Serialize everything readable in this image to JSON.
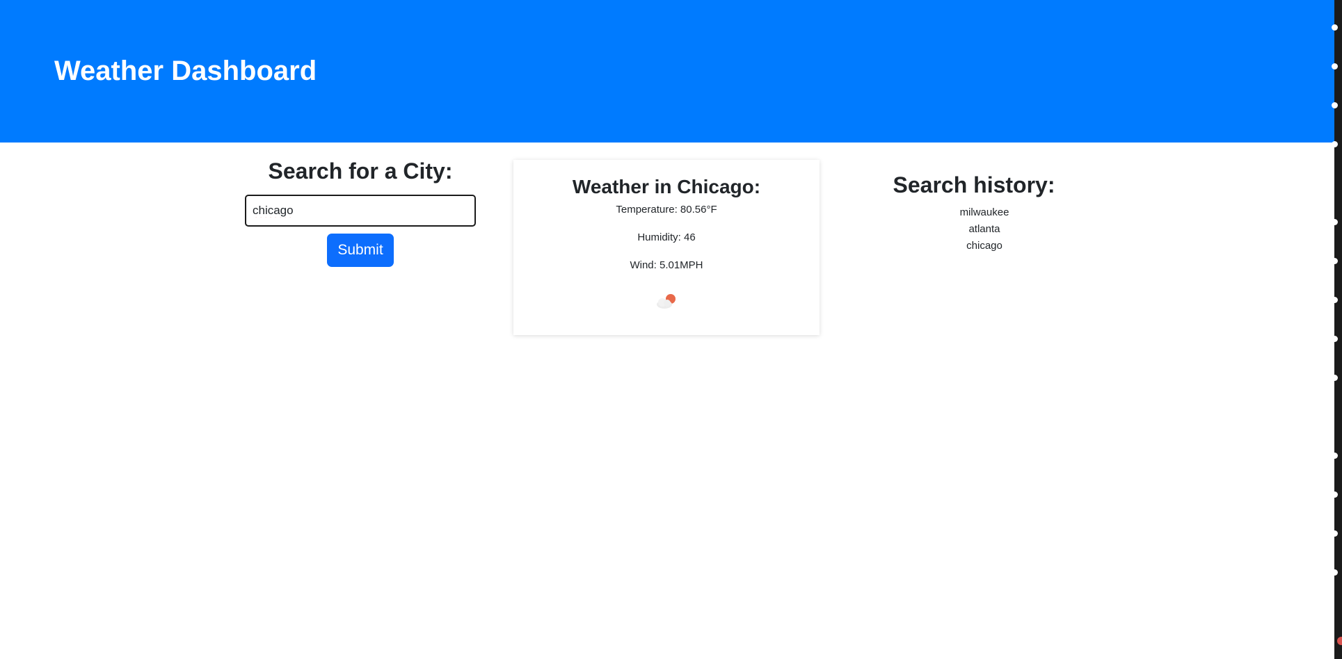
{
  "header": {
    "title": "Weather Dashboard"
  },
  "search": {
    "heading": "Search for a City:",
    "input_value": "chicago",
    "submit_label": "Submit"
  },
  "weather": {
    "title": "Weather in Chicago:",
    "temperature": "Temperature: 80.56°F",
    "humidity": "Humidity: 46",
    "wind": "Wind: 5.01MPH",
    "icon": "partly-cloudy-icon"
  },
  "history": {
    "heading": "Search history:",
    "items": [
      "milwaukee",
      "atlanta",
      "chicago"
    ]
  },
  "colors": {
    "header_bg": "#007bff",
    "button_bg": "#0d6efd",
    "text": "#212529"
  }
}
